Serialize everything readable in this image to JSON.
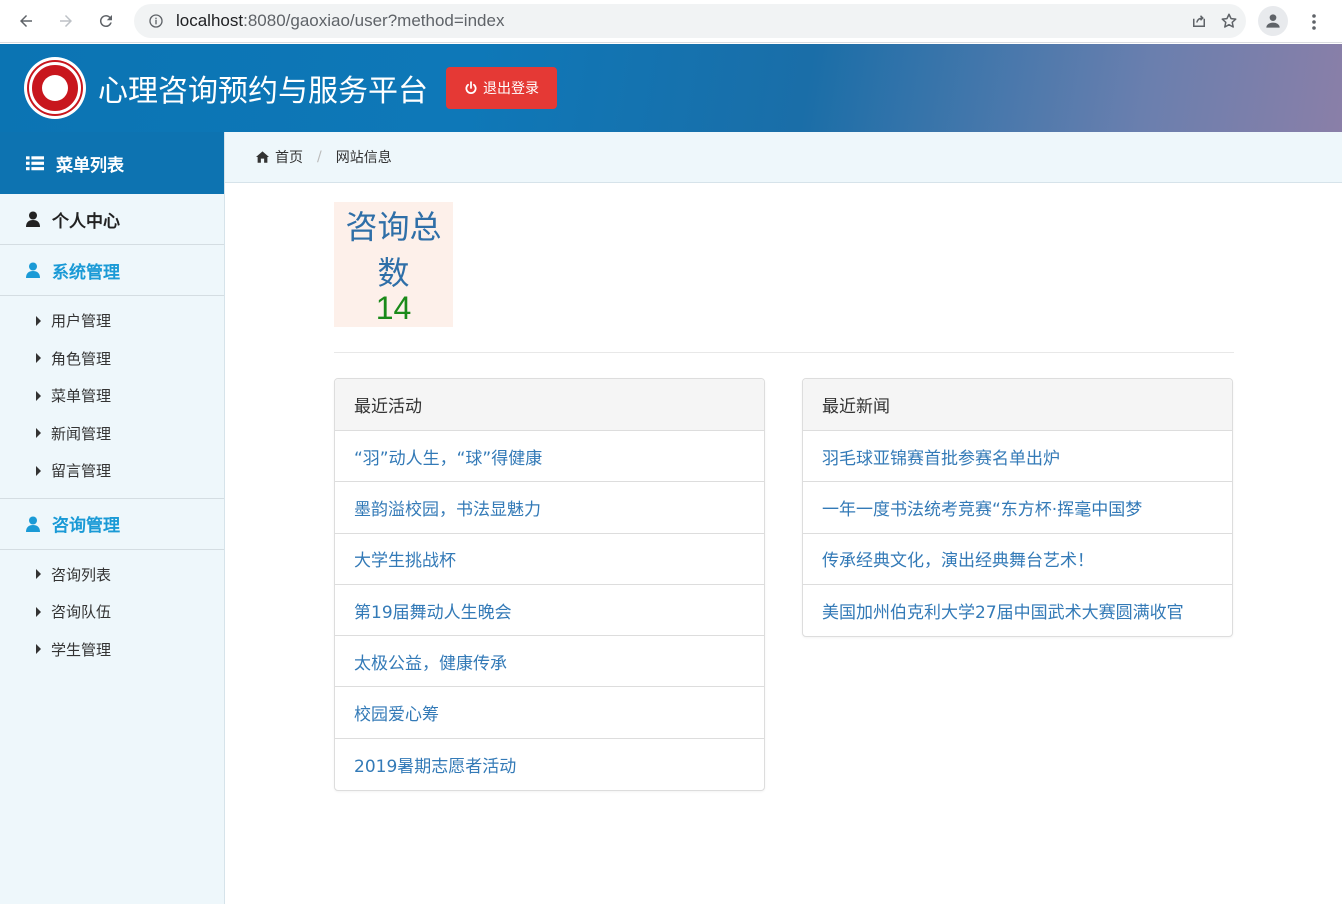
{
  "browser": {
    "url_host": "localhost",
    "url_rest": ":8080/gaoxiao/user?method=index"
  },
  "header": {
    "title": "心理咨询预约与服务平台",
    "logout_label": "退出登录"
  },
  "sidebar": {
    "menu_title": "菜单列表",
    "personal_center": "个人中心",
    "system_section": "系统管理",
    "system_items": [
      "用户管理",
      "角色管理",
      "菜单管理",
      "新闻管理",
      "留言管理"
    ],
    "consult_section": "咨询管理",
    "consult_items": [
      "咨询列表",
      "咨询队伍",
      "学生管理"
    ]
  },
  "breadcrumb": {
    "home": "首页",
    "current": "网站信息"
  },
  "stats": {
    "label": "咨询总数",
    "value": "14"
  },
  "activities": {
    "title": "最近活动",
    "items": [
      "“羽”动人生，“球”得健康",
      "墨韵溢校园，书法显魅力",
      "大学生挑战杯",
      "第19届舞动人生晚会",
      "太极公益，健康传承",
      "校园爱心筹",
      "2019暑期志愿者活动"
    ]
  },
  "news": {
    "title": "最近新闻",
    "items": [
      "羽毛球亚锦赛首批参赛名单出炉",
      "一年一度书法统考竞赛“东方杯·挥毫中国梦",
      "传承经典文化，演出经典舞台艺术！",
      "美国加州伯克利大学27届中国武术大赛圆满收官"
    ]
  },
  "colors": {
    "header_blue": "#0d73b1",
    "logout_red": "#e53935",
    "link_blue": "#337ab7",
    "section_blue": "#1a9ad6",
    "stat_green": "#1a8a1a"
  }
}
